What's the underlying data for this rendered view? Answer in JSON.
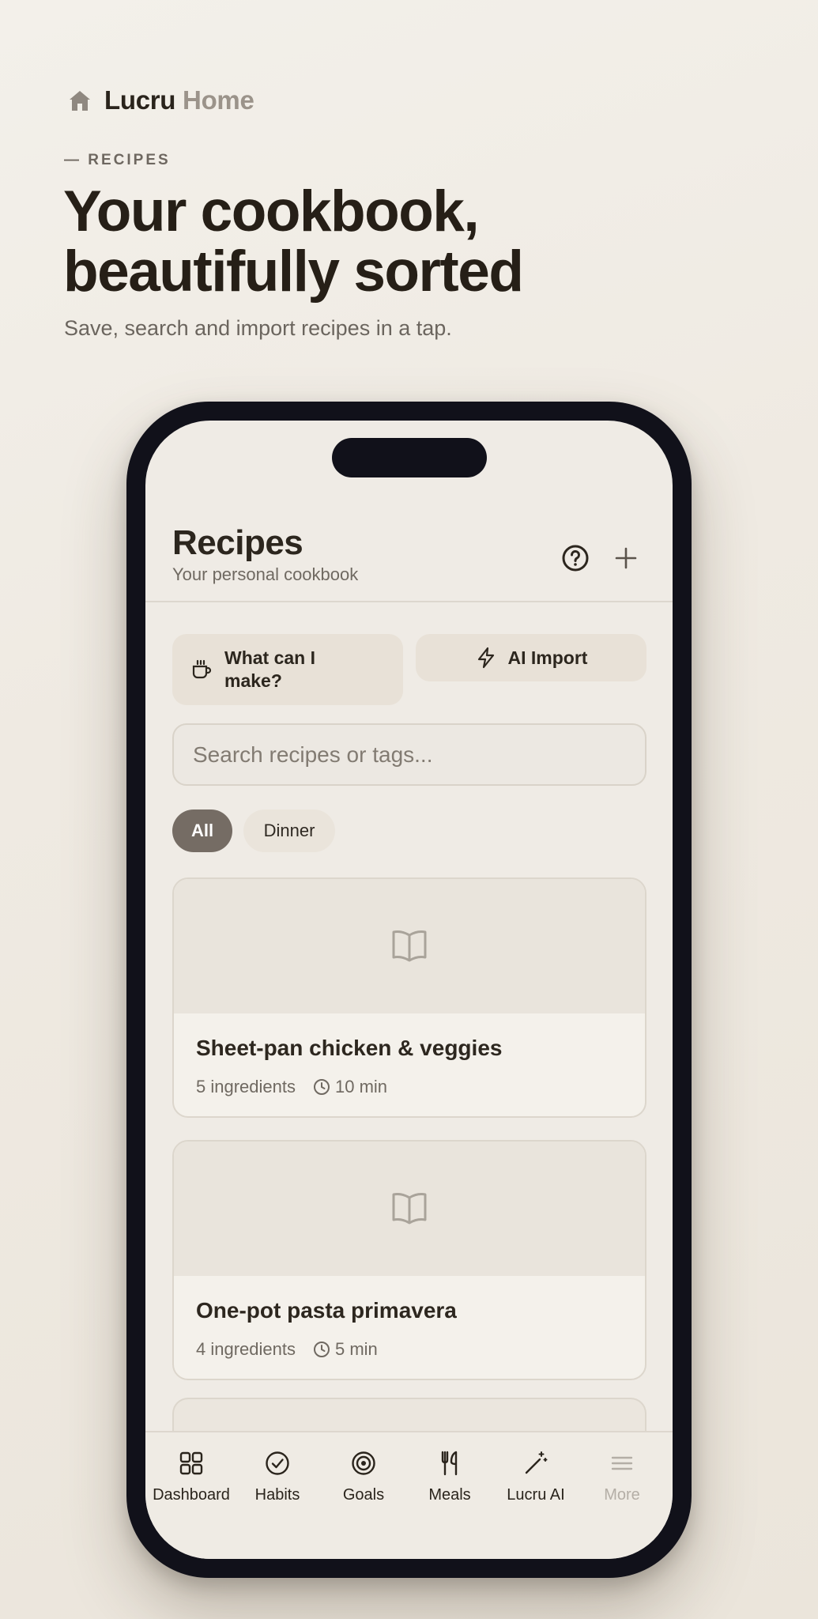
{
  "brand": {
    "name": "Lucru",
    "accent": "Home"
  },
  "hero": {
    "kicker": "— RECIPES",
    "headline_line1": "Your cookbook,",
    "headline_line2": "beautifully sorted",
    "subhead": "Save, search and import recipes in a tap."
  },
  "app": {
    "title": "Recipes",
    "subtitle": "Your personal cookbook",
    "help_icon": "help-circle-icon",
    "add_icon": "plus-icon"
  },
  "actions": {
    "what_can_i_make": "What can I make?",
    "ai_import": "AI Import"
  },
  "search": {
    "placeholder": "Search recipes or tags...",
    "value": ""
  },
  "filters": [
    {
      "label": "All",
      "selected": true
    },
    {
      "label": "Dinner",
      "selected": false
    }
  ],
  "recipes": [
    {
      "title": "Sheet-pan chicken & veggies",
      "ingredients": "5 ingredients",
      "time": "10 min"
    },
    {
      "title": "One-pot pasta primavera",
      "ingredients": "4 ingredients",
      "time": "5 min"
    }
  ],
  "tabs": [
    {
      "label": "Dashboard",
      "icon": "grid-icon"
    },
    {
      "label": "Habits",
      "icon": "check-circle-icon"
    },
    {
      "label": "Goals",
      "icon": "target-icon"
    },
    {
      "label": "Meals",
      "icon": "utensils-icon"
    },
    {
      "label": "Lucru AI",
      "icon": "magic-wand-icon"
    },
    {
      "label": "More",
      "icon": "menu-icon"
    }
  ],
  "colors": {
    "background": "#efeae2",
    "accent_chip": "#756c64",
    "text_primary": "#261f17",
    "text_muted": "#6f6961",
    "phone_frame": "#11111a"
  }
}
